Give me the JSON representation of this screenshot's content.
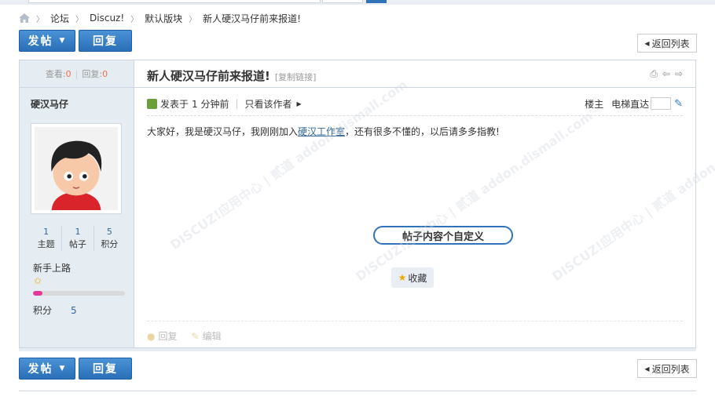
{
  "breadcrumb": [
    "论坛",
    "Discuz!",
    "默认版块",
    "新人硬汉马仔前来报道!"
  ],
  "buttons": {
    "post": "发帖",
    "reply": "回复",
    "back": "返回列表"
  },
  "stats": {
    "views_label": "查看:",
    "views": "0",
    "replies_label": "回复:",
    "replies": "0"
  },
  "author": {
    "name": "硬汉马仔",
    "counts": [
      {
        "value": "1",
        "label": "主题"
      },
      {
        "value": "1",
        "label": "帖子"
      },
      {
        "value": "5",
        "label": "积分"
      }
    ],
    "rank": "新手上路",
    "progress": 0.1,
    "score_label": "积分",
    "score": "5"
  },
  "post": {
    "title": "新人硬汉马仔前来报道!",
    "copy_link": "[复制链接]",
    "posted": "发表于",
    "time": "1 分钟前",
    "only_author": "只看该作者",
    "floor": "楼主",
    "jump_label": "电梯直达",
    "content_before": "大家好，我是硬汉马仔，我刚刚加入",
    "content_link": "硬汉工作室",
    "content_after": "，还有很多不懂的，以后请多多指教!",
    "custom_label": "帖子内容个自定义",
    "favorite": "收藏",
    "reply_action": "回复",
    "edit_action": "编辑"
  },
  "watermark": "DISCUZ!应用中心 | 贰道 addon.dismall.com",
  "colors": {
    "accent": "#2f74b9",
    "side_bg": "#e5edf2",
    "highlight": "#f26c4f",
    "progress": "#e2389a"
  }
}
